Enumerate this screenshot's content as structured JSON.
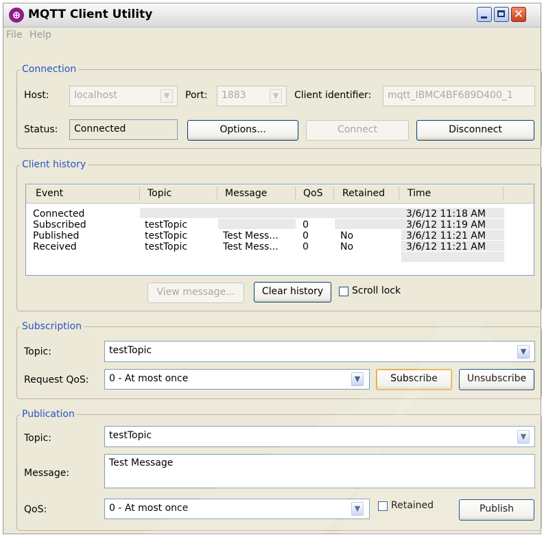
{
  "window": {
    "title": "MQTT Client Utility"
  },
  "menu": [
    "File",
    "Help"
  ],
  "connection": {
    "legend": "Connection",
    "host_label": "Host:",
    "host_value": "localhost",
    "port_label": "Port:",
    "port_value": "1883",
    "client_id_label": "Client identifier:",
    "client_id_value": "mqtt_IBMC4BF689D400_1",
    "status_label": "Status:",
    "status_value": "Connected",
    "options_label": "Options...",
    "connect_label": "Connect",
    "disconnect_label": "Disconnect"
  },
  "history": {
    "legend": "Client history",
    "columns": [
      "Event",
      "Topic",
      "Message",
      "QoS",
      "Retained",
      "Time"
    ],
    "rows": [
      [
        "Connected",
        "",
        "",
        "",
        "",
        "3/6/12 11:18 AM"
      ],
      [
        "Subscribed",
        "testTopic",
        "",
        "0",
        "",
        "3/6/12 11:19 AM"
      ],
      [
        "Published",
        "testTopic",
        "Test Mess...",
        "0",
        "No",
        "3/6/12 11:21 AM"
      ],
      [
        "Received",
        "testTopic",
        "Test Mess...",
        "0",
        "No",
        "3/6/12 11:21 AM"
      ]
    ],
    "view_label": "View message...",
    "clear_label": "Clear history",
    "scroll_lock_label": "Scroll lock"
  },
  "subscription": {
    "legend": "Subscription",
    "topic_label": "Topic:",
    "topic_value": "testTopic",
    "qos_label": "Request QoS:",
    "qos_value": "0 - At most once",
    "subscribe_label": "Subscribe",
    "unsubscribe_label": "Unsubscribe"
  },
  "publication": {
    "legend": "Publication",
    "topic_label": "Topic:",
    "topic_value": "testTopic",
    "message_label": "Message:",
    "message_value": "Test Message",
    "qos_label": "QoS:",
    "qos_value": "0 - At most once",
    "retained_label": "Retained",
    "publish_label": "Publish"
  },
  "icons": {
    "app": "mqtt-app-icon",
    "minimize": "minimize-icon",
    "maximize": "maximize-icon",
    "close": "close-icon",
    "dropdown": "chevron-down-icon"
  }
}
